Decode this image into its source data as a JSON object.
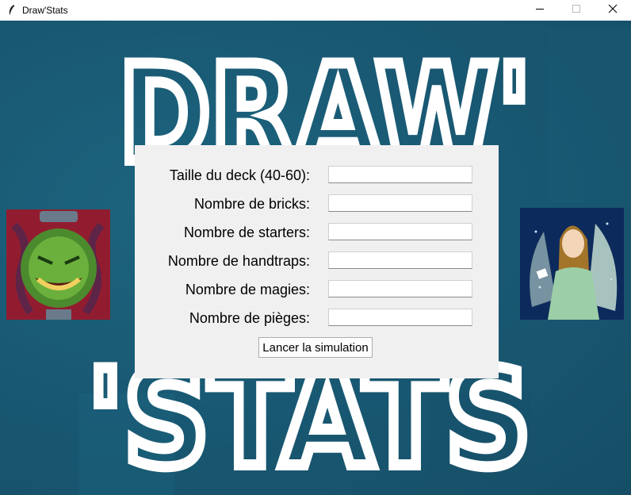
{
  "window": {
    "title": "Draw'Stats",
    "icon": "feather-icon",
    "controls": [
      "minimize-icon",
      "maximize-icon",
      "close-icon"
    ]
  },
  "background": {
    "lines": [
      "DRAW'",
      "'STATS"
    ],
    "color": "#1b5a72"
  },
  "form": {
    "fields": [
      {
        "label": "Taille du deck (40-60):",
        "value": ""
      },
      {
        "label": "Nombre de bricks:",
        "value": ""
      },
      {
        "label": "Nombre de starters:",
        "value": ""
      },
      {
        "label": "Nombre de handtraps:",
        "value": ""
      },
      {
        "label": "Nombre de magies:",
        "value": ""
      },
      {
        "label": "Nombre de pièges:",
        "value": ""
      }
    ],
    "submit_label": "Lancer la simulation"
  },
  "images": {
    "left": "pot-of-greed-card-art",
    "right": "angel-card-art"
  }
}
